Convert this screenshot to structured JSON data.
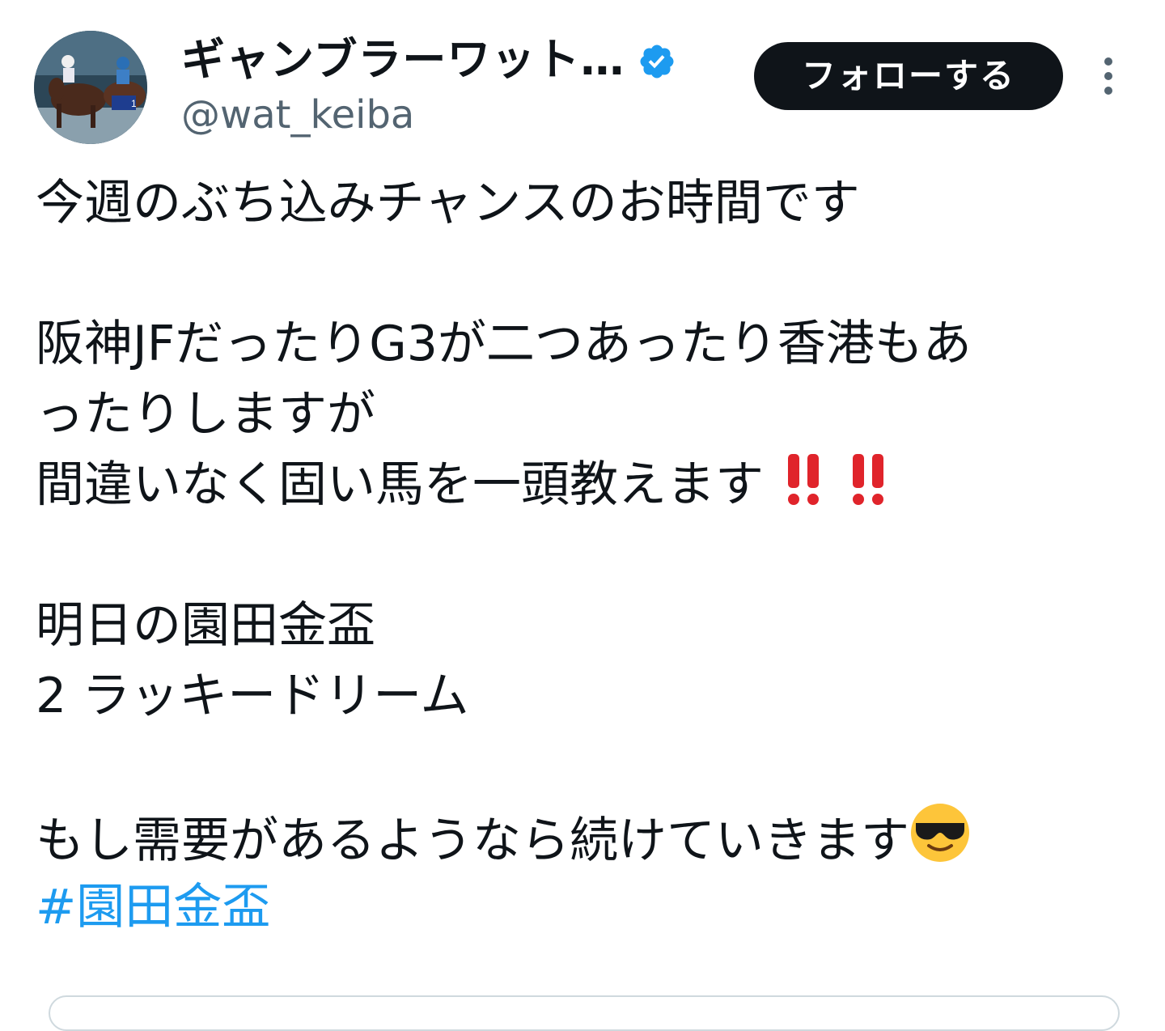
{
  "author": {
    "display_name": "ギャンブラーワット…",
    "handle": "@wat_keiba",
    "verified": true,
    "avatar": "horse-racing-photo"
  },
  "actions": {
    "follow_label": "フォローする",
    "more_icon": "more-vertical-icon"
  },
  "tweet": {
    "lines": [
      "今週のぶち込みチャンスのお時間です",
      "",
      "阪神JFだったりG3が二つあったり香港もあ",
      "ったりしますが",
      "間違いなく固い馬を一頭教えます",
      "",
      "明日の園田金盃",
      "2 ラッキードリーム",
      "",
      "もし需要があるようなら続けていきます"
    ],
    "emojis": {
      "line_5": [
        "‼",
        "‼"
      ],
      "line_10": "😎"
    },
    "hashtag": "#園田金盃"
  },
  "colors": {
    "text": "#0f1419",
    "secondary": "#536471",
    "link": "#1d9bf0",
    "verified": "#1d9bf0",
    "button_bg": "#0f1419",
    "button_text": "#ffffff",
    "emoji_red": "#e0242b",
    "emoji_yellow": "#fdc53a"
  }
}
